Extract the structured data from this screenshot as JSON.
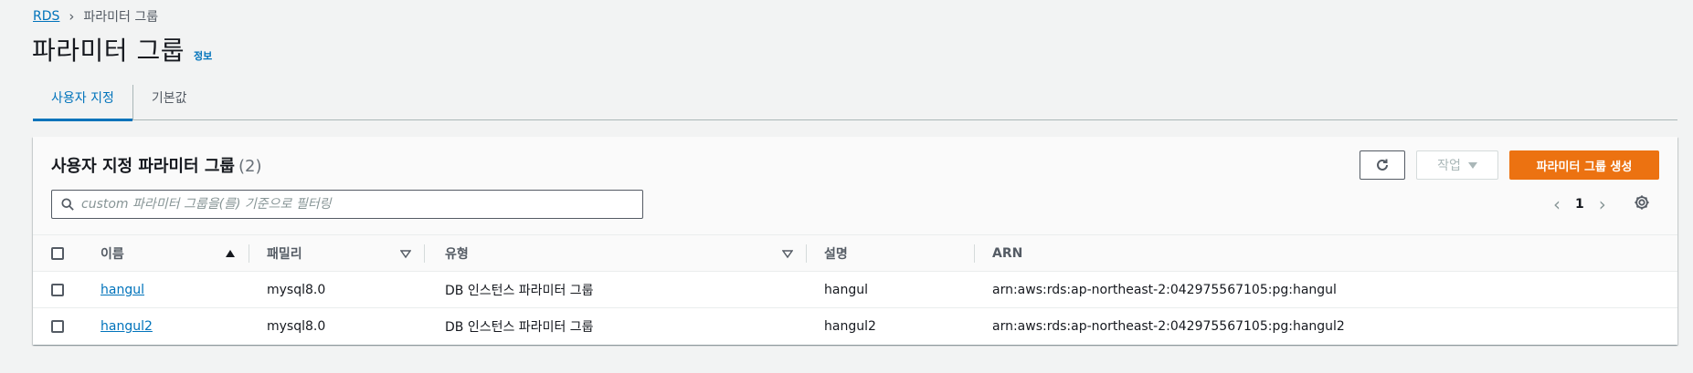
{
  "breadcrumb": {
    "root": "RDS",
    "current": "파라미터 그룹"
  },
  "page": {
    "title": "파라미터 그룹",
    "info": "정보"
  },
  "tabs": [
    {
      "label": "사용자 지정"
    },
    {
      "label": "기본값"
    }
  ],
  "panel": {
    "title": "사용자 지정 파라미터 그룹",
    "count": "(2)",
    "action_label": "작업",
    "create_label": "파라미터 그룹 생성",
    "search_placeholder": "custom 파라미터 그룹을(를) 기준으로 필터링",
    "page_number": "1"
  },
  "columns": [
    "이름",
    "패밀리",
    "유형",
    "설명",
    "ARN"
  ],
  "rows": [
    {
      "name": "hangul",
      "family": "mysql8.0",
      "type": "DB 인스턴스 파라미터 그룹",
      "description": "hangul",
      "arn": "arn:aws:rds:ap-northeast-2:042975567105:pg:hangul"
    },
    {
      "name": "hangul2",
      "family": "mysql8.0",
      "type": "DB 인스턴스 파라미터 그룹",
      "description": "hangul2",
      "arn": "arn:aws:rds:ap-northeast-2:042975567105:pg:hangul2"
    }
  ],
  "colors": {
    "link": "#0073bb",
    "primary_button": "#ec7211",
    "background": "#f2f3f3"
  }
}
